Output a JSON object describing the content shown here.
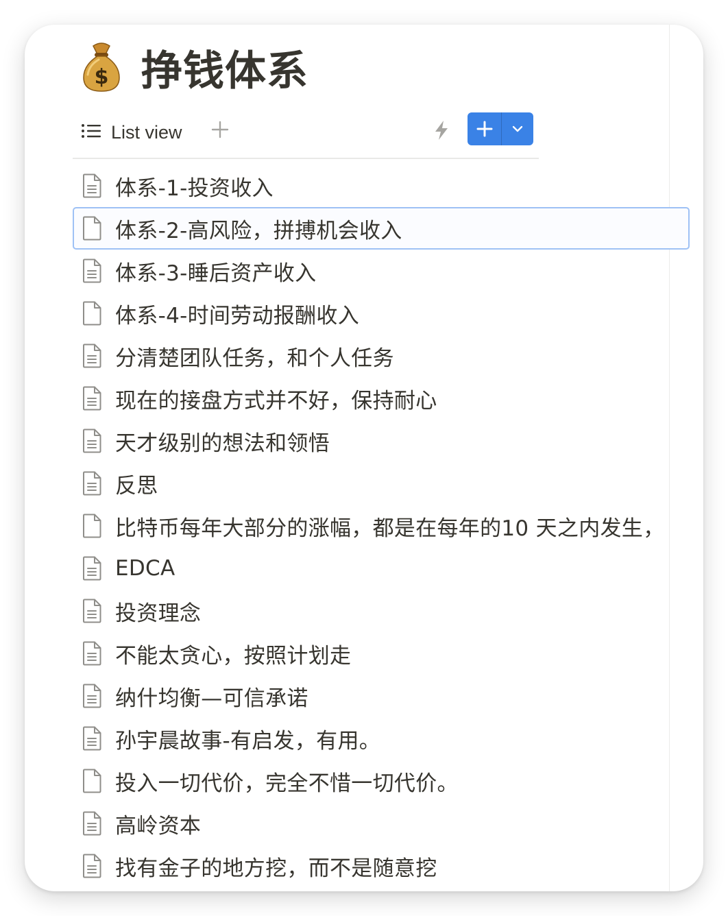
{
  "page": {
    "emoji": "money-bag-icon",
    "title": "挣钱体系"
  },
  "toolbar": {
    "view_label": "List view",
    "accent": "#3a82e6"
  },
  "items": [
    {
      "label": "体系-1-投资收入",
      "icon": "page-lines-icon"
    },
    {
      "label": "体系-2-高风险，拼搏机会收入",
      "icon": "page-icon"
    },
    {
      "label": "体系-3-睡后资产收入",
      "icon": "page-lines-icon"
    },
    {
      "label": "体系-4-时间劳动报酬收入",
      "icon": "page-icon"
    },
    {
      "label": "分清楚团队任务，和个人任务",
      "icon": "page-lines-icon"
    },
    {
      "label": "现在的接盘方式并不好，保持耐心",
      "icon": "page-lines-icon"
    },
    {
      "label": "天才级别的想法和领悟",
      "icon": "page-lines-icon"
    },
    {
      "label": "反思",
      "icon": "page-lines-icon"
    },
    {
      "label": "比特币每年大部分的涨幅，都是在每年的10 天之内发生，",
      "icon": "page-icon"
    },
    {
      "label": "EDCA",
      "icon": "page-lines-icon"
    },
    {
      "label": "投资理念",
      "icon": "page-lines-icon"
    },
    {
      "label": "不能太贪心，按照计划走",
      "icon": "page-lines-icon"
    },
    {
      "label": "纳什均衡—可信承诺",
      "icon": "page-lines-icon"
    },
    {
      "label": "孙宇晨故事-有启发，有用。",
      "icon": "page-lines-icon"
    },
    {
      "label": "投入一切代价，完全不惜一切代价。",
      "icon": "page-icon"
    },
    {
      "label": "高岭资本",
      "icon": "page-lines-icon"
    },
    {
      "label": "找有金子的地方挖，而不是随意挖",
      "icon": "page-lines-icon"
    }
  ]
}
